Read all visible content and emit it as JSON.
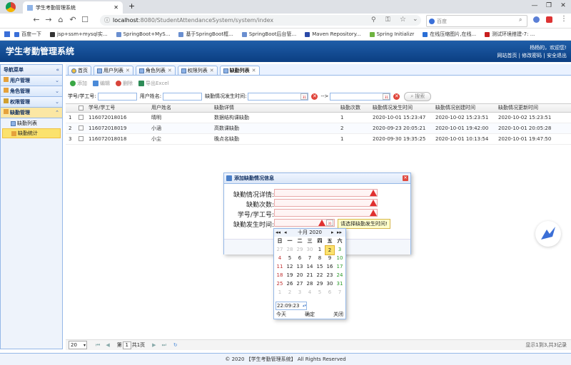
{
  "browser": {
    "tab_title": "学生考勤管理系统",
    "url_host": "localhost",
    "url_rest": ":8080/StudentAttendanceSystem/system/index",
    "search_engine": "百度",
    "bookmarks": [
      {
        "label": "百度一下",
        "color": "#3a6fd8"
      },
      {
        "label": "jsp+ssm+mysql实...",
        "color": "#333333"
      },
      {
        "label": "SpringBoot+MyS...",
        "color": "#6a8fd0"
      },
      {
        "label": "基于SpringBoot框...",
        "color": "#6a8fd0"
      },
      {
        "label": "SpringBoot后台管...",
        "color": "#6a8fd0"
      },
      {
        "label": "Maven Repository...",
        "color": "#2b4aa8"
      },
      {
        "label": "Spring Initializr",
        "color": "#6db33f"
      },
      {
        "label": "在线压缩图片,在线...",
        "color": "#2a6fd6"
      },
      {
        "label": "测试环境搭建-7: ...",
        "color": "#c81e1e"
      }
    ]
  },
  "app": {
    "title": "学生考勤管理系统",
    "welcome": "杨杨的，欢迎您!",
    "links": "网站首页 | 修改密码 | 安全退出"
  },
  "sidebar": {
    "header": "导航菜单",
    "groups": [
      {
        "label": "用户管理"
      },
      {
        "label": "角色管理"
      },
      {
        "label": "权限管理"
      },
      {
        "label": "缺勤管理"
      }
    ],
    "subitems": [
      "缺勤列表",
      "缺勤统计"
    ]
  },
  "tabs": [
    "首页",
    "用户列表",
    "角色列表",
    "权限列表",
    "缺勤列表"
  ],
  "toolbar": {
    "add": "添加",
    "edit": "编辑",
    "delete": "删除",
    "export": "导出Excel"
  },
  "filters": {
    "student_no": "学号/学工号:",
    "student_name": "用户姓名:",
    "time": "缺勤情况发生时间:",
    "arrow": "-->",
    "search": "搜索"
  },
  "grid": {
    "columns": [
      "学号/学工号",
      "用户姓名",
      "缺勤详情",
      "缺勤次数",
      "缺勤情况发生时间",
      "缺勤情况创建时间",
      "缺勤情况更新时间"
    ],
    "rows": [
      {
        "num": "1",
        "cells": [
          "116072018016",
          "晴明",
          "数据结构课缺勤",
          "1",
          "2020-10-01 15:23:47",
          "2020-10-02 15:23:51",
          "2020-10-02 15:23:51"
        ]
      },
      {
        "num": "2",
        "cells": [
          "116072018019",
          "小涵",
          "高数课缺勤",
          "2",
          "2020-09-23 20:05:21",
          "2020-10-01 19:42:00",
          "2020-10-01 20:05:28"
        ]
      },
      {
        "num": "3",
        "cells": [
          "116072018018",
          "小尘",
          "晚点名缺勤",
          "1",
          "2020-09-30 19:35:25",
          "2020-10-01 10:13:54",
          "2020-10-01 19:47:50"
        ]
      }
    ]
  },
  "pager": {
    "size": "20",
    "page_prefix": "第",
    "page_value": "1",
    "page_suffix": "共1页",
    "summary": "显示1到3,共3记录"
  },
  "footer": "© 2020 【学生考勤管理系统】 All Rights Reserved",
  "dialog": {
    "title": "添加缺勤情况信息",
    "fields": [
      "缺勤情况详情:",
      "缺勤次数:",
      "学号/学工号:",
      "缺勤发生时间:"
    ],
    "tooltip": "请选择缺勤发生时间!"
  },
  "calendar": {
    "month": "十月 2020",
    "weekdays": [
      "日",
      "一",
      "二",
      "三",
      "四",
      "五",
      "六"
    ],
    "weeks": [
      [
        "27",
        "28",
        "29",
        "30",
        "1",
        "2",
        "3"
      ],
      [
        "4",
        "5",
        "6",
        "7",
        "8",
        "9",
        "10"
      ],
      [
        "11",
        "12",
        "13",
        "14",
        "15",
        "16",
        "17"
      ],
      [
        "18",
        "19",
        "20",
        "21",
        "22",
        "23",
        "24"
      ],
      [
        "25",
        "26",
        "27",
        "28",
        "29",
        "30",
        "31"
      ],
      [
        "1",
        "2",
        "3",
        "4",
        "5",
        "6",
        "7"
      ]
    ],
    "time": "22:09:23",
    "today": "今天",
    "ok": "确定",
    "close": "关闭"
  }
}
